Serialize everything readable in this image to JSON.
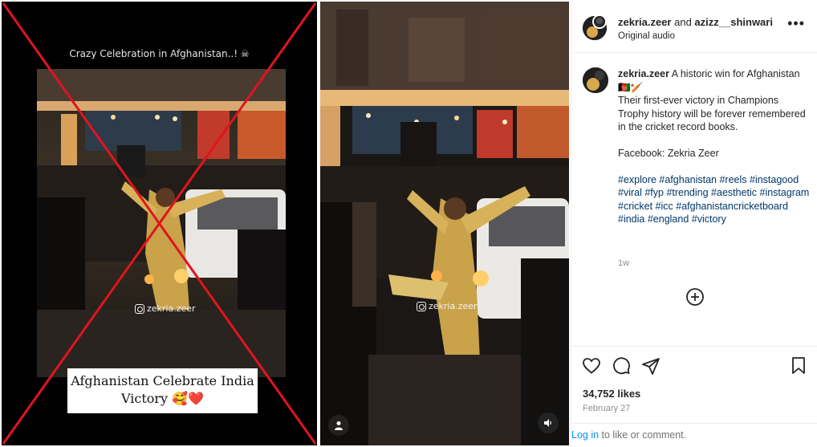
{
  "left_panel": {
    "caption": "Crazy Celebration in Afghanistan..! ☠",
    "watermark": "zekria.zeer",
    "bottom_text_line1": "Afghanistan Celebrate India",
    "bottom_text_line2": "Victory 🥰❤️",
    "cross_color": "#e0141e"
  },
  "reel": {
    "watermark": "zekria.zeer",
    "user_icon": "person-icon",
    "sound_icon": "speaker-icon"
  },
  "post": {
    "header_user1": "zekria.zeer",
    "header_and": " and ",
    "header_user2": "azizz__shinwari",
    "audio": "Original audio",
    "caption_user": "zekria.zeer",
    "caption_line1": " A historic win for Afghanistan 🇦🇫🏏",
    "caption_line2": "Their first-ever victory in Champions Trophy history will be forever remembered in the cricket record books.",
    "caption_facebook": "Facebook: Zekria Zeer",
    "hashtags": "#explore #afghanistan #reels #instagood #viral #fyp #trending #aesthetic #instagram #cricket #icc #afghanistancricketboard #india #england #victory",
    "time_ago": "1w",
    "likes": "34,752 likes",
    "date": "February 27",
    "login_link": "Log in",
    "login_rest": " to like or comment."
  }
}
